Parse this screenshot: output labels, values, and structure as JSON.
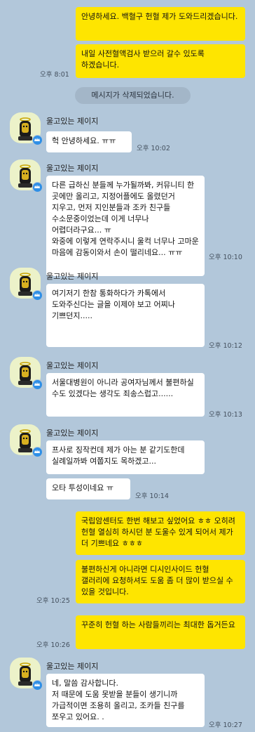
{
  "sender_name": "울고있는 제이지",
  "deleted_notice": "메시지가 삭제되었습니다.",
  "messages": {
    "m1": "안녕하세요. 백혈구 헌혈 제가 도와드리겠습니다.",
    "m2": "내일 사전혈액검사 받으러 갈수 있도록 하겠습니다.",
    "t2": "오후 8:01",
    "r1": "헉 안녕하세요. ㅠㅠ",
    "rt1": "오후 10:02",
    "r2": "다른 급하신 분들께 누가될까봐, 커뮤니티 한 곳에만 올리고, 지정어플에도 올렸던거 지우고, 먼저 지인분들과 조카 친구들 수소문중이었는데 이게 너무나 어렵더라구요... ㅠ\n와중에 이렇게 연락주시니 울컥 너무나 고마운 마음에 감동이와서 손이 떨리네요... ㅠㅠ",
    "rt2": "오후 10:10",
    "r3": "여기저기 한참 통화하다가 카톡에서 도와주신다는 글을 이제야 보고 어찌나 기쁘던지.....",
    "rt3": "오후 10:12",
    "r4": "서울대병원이 아니라 공여자님께서 불편하실 수도 있겠다는 생각도 죄송스럽고......",
    "rt4": "오후 10:13",
    "r5": "프사로 징작컨데 제가 아는 분 같기도한데 실례일까봐 여쭙지도 목하겠고...",
    "r6": "오타 투성이네요 ㅠ",
    "rt6": "오후 10:14",
    "m3": "국립암센터도 한번 해보고 싶었어요 ㅎㅎ 오히려 헌혈 열심히 하시던 분 도울수 있게 되어서 제가 더 기쁘네요 ㅎㅎㅎ",
    "m4": "불편하신게 아니라면 디시인사이드 헌혈 갤러리에 요청하셔도 도움 좀 더 많이 받으실 수 있을 것입니다.",
    "t4": "오후 10:25",
    "m5": "꾸준히 헌혈 하는 사람들끼리는 최대한 돕거든요",
    "t5": "오후 10:26",
    "r7": "네, 말씀 감사합니다.\n저 때문에 도움 못받을 분들이 생기니까 가급적이면 조용히 올리고, 조카들 친구를 쪼우고 있어요. .",
    "rt7": "오후 10:27"
  },
  "icons": {
    "avatar": "profile-photo-character",
    "badge": "crown-icon",
    "badge_color": "#2f8fe6",
    "my_bubble_color": "#fee500",
    "their_bubble_color": "#ffffff",
    "background_color": "#b2c7da"
  }
}
